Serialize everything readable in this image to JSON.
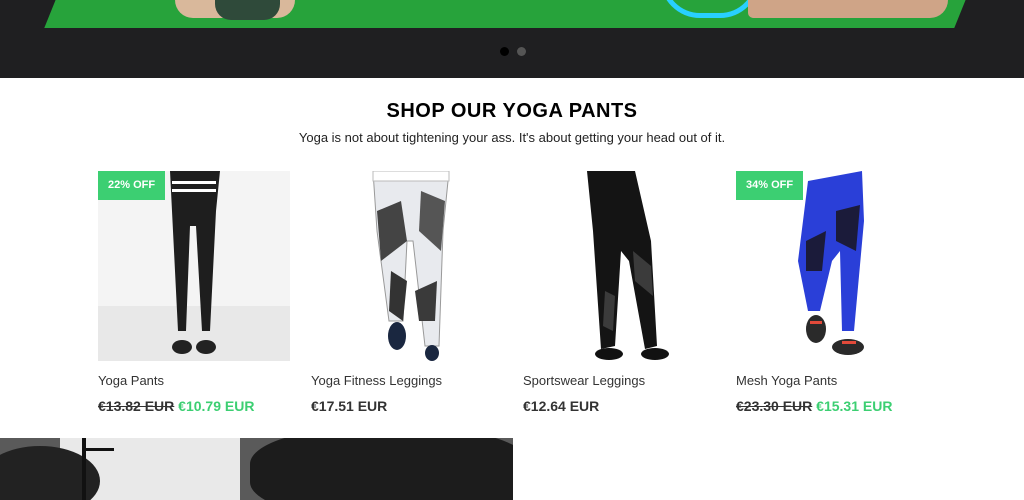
{
  "hero": {
    "slides": 2,
    "active_slide": 1
  },
  "section": {
    "title": "SHOP OUR YOGA PANTS",
    "subtitle": "Yoga is not about tightening your ass.  It's about getting your head out of it."
  },
  "products": [
    {
      "badge": "22% OFF",
      "name": "Yoga Pants",
      "old_price": "€13.82 EUR",
      "price": "€10.79 EUR",
      "pant_color": "#1e1e1e"
    },
    {
      "badge": "",
      "name": "Yoga Fitness Leggings",
      "old_price": "",
      "price": "€17.51 EUR",
      "pant_color": "#e8eaee"
    },
    {
      "badge": "",
      "name": "Sportswear Leggings",
      "old_price": "",
      "price": "€12.64 EUR",
      "pant_color": "#141414"
    },
    {
      "badge": "34% OFF",
      "name": "Mesh Yoga Pants",
      "old_price": "€23.30 EUR",
      "price": "€15.31 EUR",
      "pant_color": "#2a3fd8"
    }
  ],
  "colors": {
    "accent": "#3ccf72",
    "hero_bg": "#1f1f21",
    "mat": "#27a33b"
  }
}
